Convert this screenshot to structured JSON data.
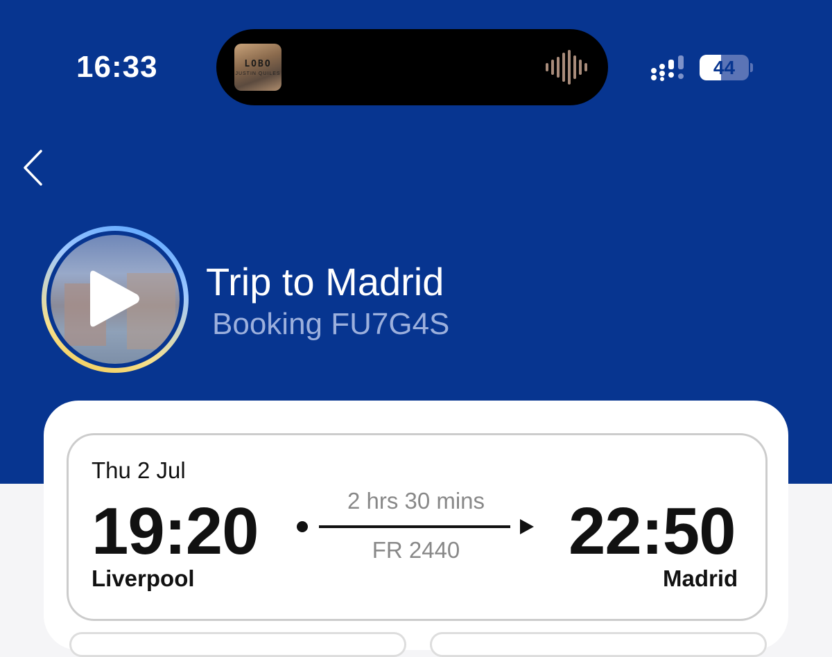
{
  "status_bar": {
    "time": "16:33",
    "battery_percent": "44",
    "battery_level": 0.44,
    "now_playing": {
      "art_title": "LOBO",
      "art_artist": "JUSTIN QUILES",
      "icon": "waveform-icon"
    }
  },
  "nav": {
    "back_icon": "chevron-left-icon"
  },
  "trip": {
    "title": "Trip to Madrid",
    "booking": "Booking FU7G4S",
    "play_icon": "play-icon"
  },
  "flight": {
    "date": "Thu 2 Jul",
    "departure_time": "19:20",
    "departure_city": "Liverpool",
    "arrival_time": "22:50",
    "arrival_city": "Madrid",
    "duration": "2 hrs 30 mins",
    "flight_number": "FR 2440"
  },
  "colors": {
    "brand_blue": "#073590",
    "text_dark": "#111111",
    "text_muted": "#888888",
    "booking_text": "#9cb0dd"
  }
}
